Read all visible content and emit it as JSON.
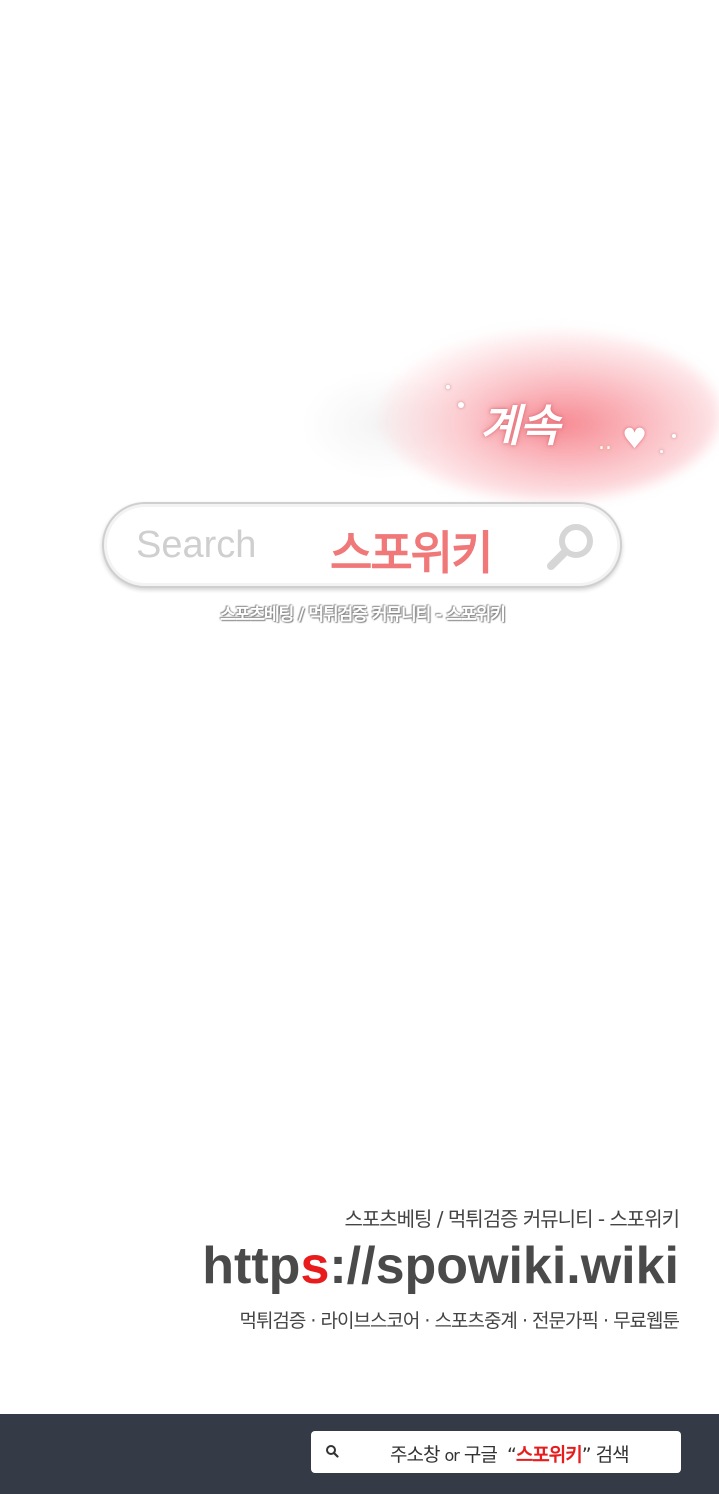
{
  "continued": {
    "text": "계속",
    "dots": "..",
    "heart_icon": "heart-icon"
  },
  "search": {
    "placeholder": "Search",
    "brand": "스포위키",
    "icon": "search-icon",
    "subtitle": "스포츠베팅 / 먹튀검증 커뮤니티 - 스포위키"
  },
  "footer": {
    "tagline": "스포츠베팅 / 먹튀검증 커뮤니티 - 스포위키",
    "url_part1": "http",
    "url_highlight": "s",
    "url_part2": "://spowiki.wiki",
    "links": "먹튀검증 · 라이브스코어 · 스포츠중계 · 전문가픽 · 무료웹툰"
  },
  "address_bar": {
    "icon": "search-icon",
    "prefix": "주소창",
    "or": "or",
    "google": "구글",
    "open_quote": "“",
    "keyword": "스포위키",
    "close_quote": "”",
    "suffix": "검색"
  },
  "colors": {
    "brand_pink": "#f07878",
    "url_red": "#e81c1c",
    "bottom_bar": "#353b46"
  }
}
